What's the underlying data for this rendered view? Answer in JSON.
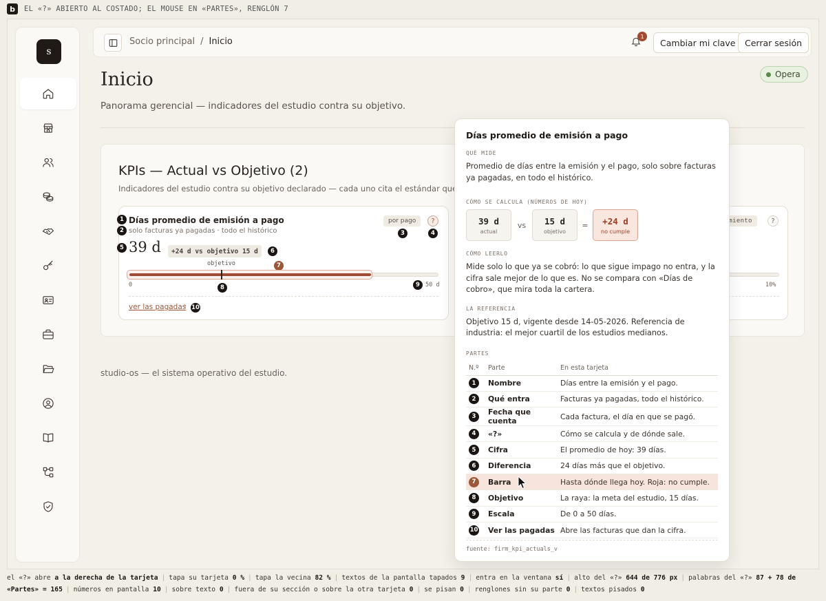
{
  "caption": {
    "logo": "b",
    "text": "EL «?» ABIERTO AL COSTADO; EL MOUSE EN «PARTES», RENGLÓN 7"
  },
  "sidebar": {
    "logo": "s",
    "items": [
      {
        "icon": "home-icon",
        "active": true
      },
      {
        "icon": "storefront-icon"
      },
      {
        "icon": "users-icon"
      },
      {
        "icon": "coins-icon"
      },
      {
        "icon": "handshake-icon"
      },
      {
        "icon": "key-icon"
      },
      {
        "icon": "id-card-icon"
      },
      {
        "icon": "briefcase-icon"
      },
      {
        "icon": "folder-icon"
      },
      {
        "icon": "user-circle-icon"
      },
      {
        "icon": "book-icon"
      },
      {
        "icon": "workflow-icon"
      },
      {
        "icon": "shield-check-icon"
      }
    ]
  },
  "header": {
    "breadcrumb_root": "Socio principal",
    "breadcrumb_sep": "/",
    "breadcrumb_current": "Inicio",
    "notif_count": "1",
    "change_password": "Cambiar mi clave",
    "logout": "Cerrar sesión"
  },
  "status": {
    "label": "Opera",
    "color": "#5a8a4b"
  },
  "page": {
    "title": "Inicio",
    "subtitle": "Panorama gerencial — indicadores del estudio contra su objetivo.",
    "footer": "studio-os — el sistema operativo del estudio."
  },
  "kpis": {
    "title": "KPIs — Actual vs Objetivo (2)",
    "description": "Indicadores del estudio contra su objetivo declarado — cada uno cita el estándar que lo inspira.",
    "card1": {
      "name": "Días promedio de emisión a pago",
      "subtitle": "solo facturas ya pagadas · todo el histórico",
      "chip": "por pago",
      "help": "?",
      "value": "39 d",
      "delta": "+24 d vs objetivo 15 d",
      "objective_label": "objetivo",
      "scale_min": "0",
      "scale_max": "50 d",
      "link": "ver las pagadas",
      "chevron": "›",
      "progress": {
        "actual": 39,
        "objective": 15,
        "max": 50
      },
      "markers": [
        "1",
        "2",
        "3",
        "4",
        "5",
        "6",
        "7",
        "8",
        "9",
        "10"
      ]
    },
    "card2": {
      "chip": "cimiento",
      "help": "?",
      "scale_max": "10%"
    }
  },
  "popover": {
    "title": "Días promedio de emisión a pago",
    "what_label": "QUÉ MIDE",
    "what_text": "Promedio de días entre la emisión y el pago, solo sobre facturas ya pagadas, en todo el histórico.",
    "calc_label": "CÓMO SE CALCULA (NÚMEROS DE HOY)",
    "calc": {
      "actual_value": "39 d",
      "actual_label": "actual",
      "vs": "vs",
      "objective_value": "15 d",
      "objective_label": "objetivo",
      "eq": "=",
      "result_value": "+24 d",
      "result_label": "no cumple"
    },
    "read_label": "CÓMO LEERLO",
    "read_text": "Mide solo lo que ya se cobró: lo que sigue impago no entra, y la cifra sale mejor de lo que es. No se compara con «Días de cobro», que mira toda la cartera.",
    "ref_label": "LA REFERENCIA",
    "ref_text": "Objetivo 15 d, vigente desde 14-05-2026. Referencia de industria: el mejor cuartil de los estudios medianos.",
    "parts_label": "PARTES",
    "parts_headers": {
      "n": "N.º",
      "part": "Parte",
      "card": "En esta tarjeta"
    },
    "parts": [
      {
        "n": "1",
        "part": "Nombre",
        "desc": "Días entre la emisión y el pago."
      },
      {
        "n": "2",
        "part": "Qué entra",
        "desc": "Facturas ya pagadas, todo el histórico."
      },
      {
        "n": "3",
        "part": "Fecha que cuenta",
        "desc": "Cada factura, el día en que se pagó."
      },
      {
        "n": "4",
        "part": "«?»",
        "desc": "Cómo se calcula y de dónde sale."
      },
      {
        "n": "5",
        "part": "Cifra",
        "desc": "El promedio de hoy: 39 días."
      },
      {
        "n": "6",
        "part": "Diferencia",
        "desc": "24 días más que el objetivo."
      },
      {
        "n": "7",
        "part": "Barra",
        "desc": "Hasta dónde llega hoy. Roja: no cumple."
      },
      {
        "n": "8",
        "part": "Objetivo",
        "desc": "La raya: la meta del estudio, 15 días."
      },
      {
        "n": "9",
        "part": "Escala",
        "desc": "De 0 a 50 días."
      },
      {
        "n": "10",
        "part": "Ver las pagadas",
        "desc": "Abre las facturas que dan la cifra."
      }
    ],
    "highlight_row": 7,
    "source": "fuente: firm_kpi_actuals_v"
  },
  "metrics": [
    {
      "label": "el «?» abre",
      "value": "a la derecha de la tarjeta"
    },
    {
      "label": "tapa su tarjeta",
      "value": "0 %"
    },
    {
      "label": "tapa la vecina",
      "value": "82 %"
    },
    {
      "label": "textos de la pantalla tapados",
      "value": "9"
    },
    {
      "label": "entra en la ventana",
      "value": "sí"
    },
    {
      "label": "alto del «?»",
      "value": "644 de 776 px"
    },
    {
      "label": "palabras del «?»",
      "value": "87 + 78 de «Partes» = 165"
    },
    {
      "label": "números en pantalla",
      "value": "10"
    },
    {
      "label": "sobre texto",
      "value": "0"
    },
    {
      "label": "fuera de su sección o sobre la otra tarjeta",
      "value": "0"
    },
    {
      "label": "se pisan",
      "value": "0"
    },
    {
      "label": "renglones sin su parte",
      "value": "0"
    },
    {
      "label": "textos pisados",
      "value": "0"
    }
  ],
  "colors": {
    "accent": "#9c5638",
    "bar": "#a04a33",
    "ok": "#5a8a4b"
  }
}
